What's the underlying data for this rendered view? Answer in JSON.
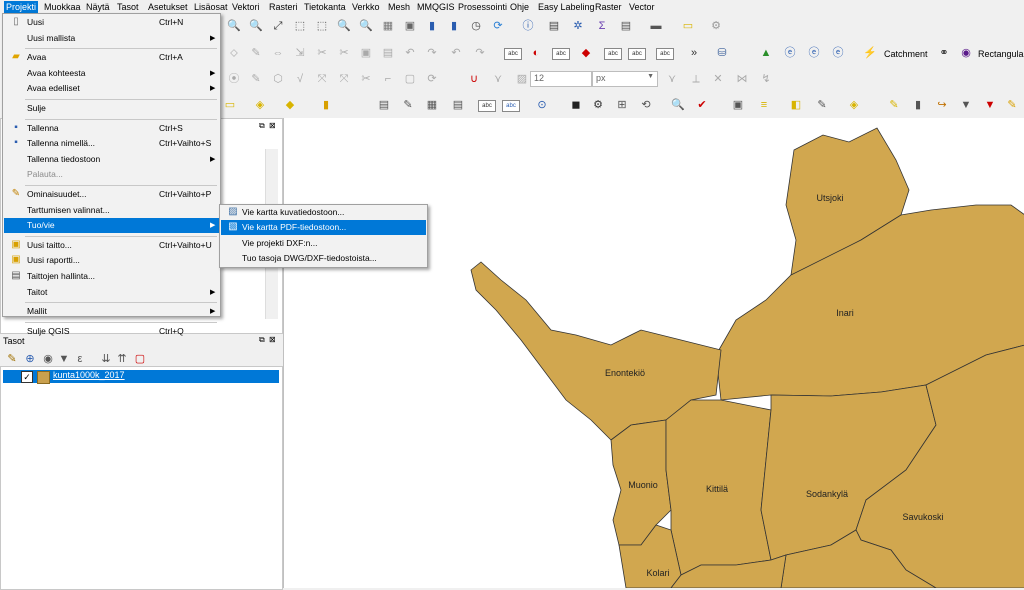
{
  "menubar": [
    {
      "label": "Projekti",
      "active": true
    },
    {
      "label": "Muokkaa"
    },
    {
      "label": "Näytä"
    },
    {
      "label": "Tasot"
    },
    {
      "label": "Asetukset"
    },
    {
      "label": "Lisäosat"
    },
    {
      "label": "Vektori"
    },
    {
      "label": "Rasteri"
    },
    {
      "label": "Tietokanta"
    },
    {
      "label": "Verkko"
    },
    {
      "label": "Mesh"
    },
    {
      "label": "MMQGIS"
    },
    {
      "label": "Prosessointi"
    },
    {
      "label": "Ohje"
    },
    {
      "label": "Easy Labeling"
    },
    {
      "label": "Raster"
    },
    {
      "label": "Vector"
    }
  ],
  "project_menu": [
    {
      "label": "Uusi",
      "shortcut": "Ctrl+N",
      "icon": "new-file-icon"
    },
    {
      "label": "Uusi mallista",
      "submenu": true
    },
    {
      "separator": true
    },
    {
      "label": "Avaa",
      "shortcut": "Ctrl+A",
      "icon": "open-folder-icon"
    },
    {
      "label": "Avaa kohteesta",
      "submenu": true
    },
    {
      "label": "Avaa edelliset",
      "submenu": true
    },
    {
      "separator": true
    },
    {
      "label": "Sulje"
    },
    {
      "separator": true
    },
    {
      "label": "Tallenna",
      "shortcut": "Ctrl+S",
      "icon": "save-icon"
    },
    {
      "label": "Tallenna nimellä...",
      "shortcut": "Ctrl+Vaihto+S",
      "icon": "save-as-icon"
    },
    {
      "label": "Tallenna tiedostoon",
      "submenu": true
    },
    {
      "label": "Palauta...",
      "disabled": true
    },
    {
      "separator": true
    },
    {
      "label": "Ominaisuudet...",
      "shortcut": "Ctrl+Vaihto+P",
      "icon": "properties-icon"
    },
    {
      "label": "Tarttumisen valinnat..."
    },
    {
      "label": "Tuo/vie",
      "submenu": true,
      "highlighted": true
    },
    {
      "separator": true
    },
    {
      "label": "Uusi taitto...",
      "shortcut": "Ctrl+Vaihto+U",
      "icon": "new-layout-icon"
    },
    {
      "label": "Uusi raportti...",
      "icon": "new-report-icon"
    },
    {
      "label": "Taittojen hallinta...",
      "icon": "layout-manager-icon"
    },
    {
      "label": "Taitot",
      "submenu": true
    },
    {
      "separator": true
    },
    {
      "label": "Mallit",
      "submenu": true
    },
    {
      "separator": true
    },
    {
      "label": "Sulje QGIS",
      "shortcut": "Ctrl+Q"
    }
  ],
  "import_export_submenu": [
    {
      "label": "Vie kartta kuvatiedostoon...",
      "icon": "export-image-icon"
    },
    {
      "label": "Vie kartta PDF-tiedostoon...",
      "icon": "export-pdf-icon",
      "highlighted": true
    },
    {
      "label": "Vie projekti DXF:n..."
    },
    {
      "label": "Tuo tasoja DWG/DXF-tiedostoista..."
    }
  ],
  "toolbar": {
    "plugin_label_catchment": "Catchment",
    "plugin_label_rectangular": "Rectangular",
    "snap_tolerance_value": "12",
    "snap_unit_value": "px"
  },
  "layers_panel": {
    "title": "Tasot",
    "layers": [
      {
        "name": "kunta1000k_2017",
        "checked": true,
        "color": "#c9a04e"
      }
    ]
  },
  "map": {
    "fill_color": "#d1a74f",
    "labels": [
      "Utsjoki",
      "Inari",
      "Enontekiö",
      "Muonio",
      "Kittilä",
      "Sodankylä",
      "Savukoski",
      "Kolari"
    ]
  }
}
